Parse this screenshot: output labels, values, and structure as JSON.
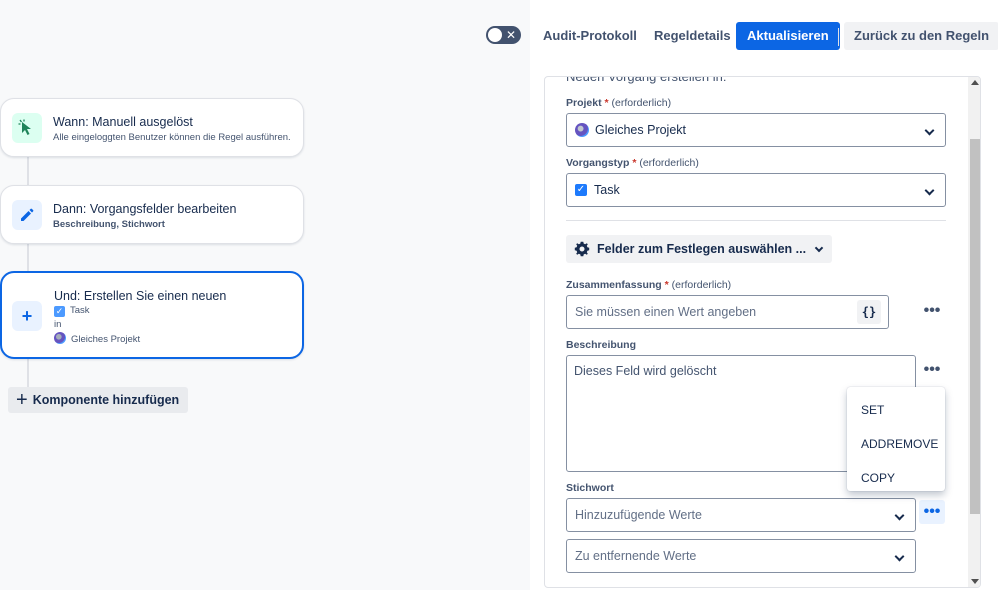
{
  "topbar": {
    "audit_label": "Audit-Protokoll",
    "details_label": "Regeldetails",
    "update_label": "Aktualisieren",
    "back_label": "Zurück zu den Regeln"
  },
  "flow": {
    "trigger": {
      "title": "Wann: Manuell ausgelöst",
      "subtitle": "Alle eingeloggten Benutzer können die Regel ausführen."
    },
    "action1": {
      "title": "Dann: Vorgangsfelder bearbeiten",
      "subtitle": "Beschreibung, Stichwort"
    },
    "action2": {
      "title": "Und: Erstellen Sie einen neuen",
      "issue_type": "Task",
      "in_label": "in",
      "project": "Gleiches Projekt"
    },
    "add_component_label": "Komponente hinzufügen"
  },
  "panel": {
    "section_title": "Neuen Vorgang erstellen in:",
    "project": {
      "label": "Projekt",
      "required_mark": "*",
      "hint": "(erforderlich)",
      "value": "Gleiches Projekt"
    },
    "issue_type": {
      "label": "Vorgangstyp",
      "required_mark": "*",
      "hint": "(erforderlich)",
      "value": "Task"
    },
    "fields_button_label": "Felder zum Festlegen auswählen ...",
    "summary": {
      "label": "Zusammenfassung",
      "required_mark": "*",
      "hint": "(erforderlich)",
      "placeholder": "Sie müssen einen Wert angeben",
      "var_button": "{}"
    },
    "description": {
      "label": "Beschreibung",
      "value": "Dieses Feld wird gelöscht"
    },
    "labels": {
      "label": "Stichwort",
      "add_placeholder": "Hinzuzufügende Werte",
      "remove_placeholder": "Zu entfernende Werte"
    }
  },
  "menu": {
    "items": [
      "SET",
      "ADDREMOVE",
      "COPY"
    ]
  },
  "colors": {
    "primary": "#0c66e4",
    "selected_border": "#0c66e4",
    "trigger_icon_bg": "#dcfff1",
    "action_icon_bg": "#e9f2ff"
  }
}
